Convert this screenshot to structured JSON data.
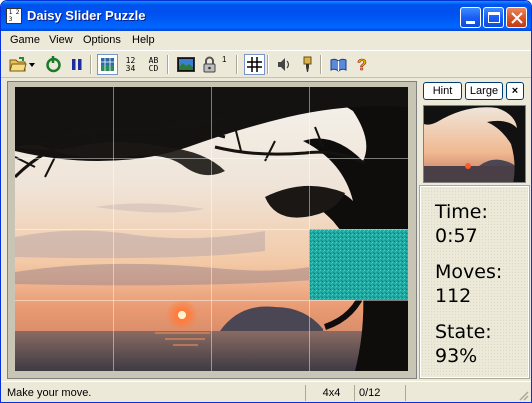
{
  "window": {
    "title": "Daisy Slider Puzzle"
  },
  "menu": {
    "items": [
      "Game",
      "View",
      "Options",
      "Help"
    ]
  },
  "toolbar": {
    "icons": [
      "open-folder-icon",
      "dropdown-arrow-icon",
      "restart-icon",
      "pause-icon",
      "show-picture-icon",
      "numbers-icon",
      "letters-icon",
      "image-icon",
      "lock-icon",
      "grid-icon",
      "sound-icon",
      "brush-icon",
      "book-icon",
      "help-icon"
    ],
    "numbers_label": "12\n34",
    "letters_label": "AB\nCD",
    "lock_count": "1"
  },
  "side": {
    "hint_label": "Hint",
    "large_label": "Large",
    "close_label": "×"
  },
  "stats": {
    "time_label": "Time:",
    "time_value": "0:57",
    "moves_label": "Moves:",
    "moves_value": "112",
    "state_label": "State:",
    "state_value": "93%"
  },
  "status": {
    "message": "Make your move.",
    "grid_size": "4x4",
    "progress": "0/12"
  },
  "colors": {
    "title_bar": "#0054e3",
    "empty_tile": "#1fa7a0",
    "sky_warm": "#f3c29c",
    "sun": "#ff6a2a"
  }
}
